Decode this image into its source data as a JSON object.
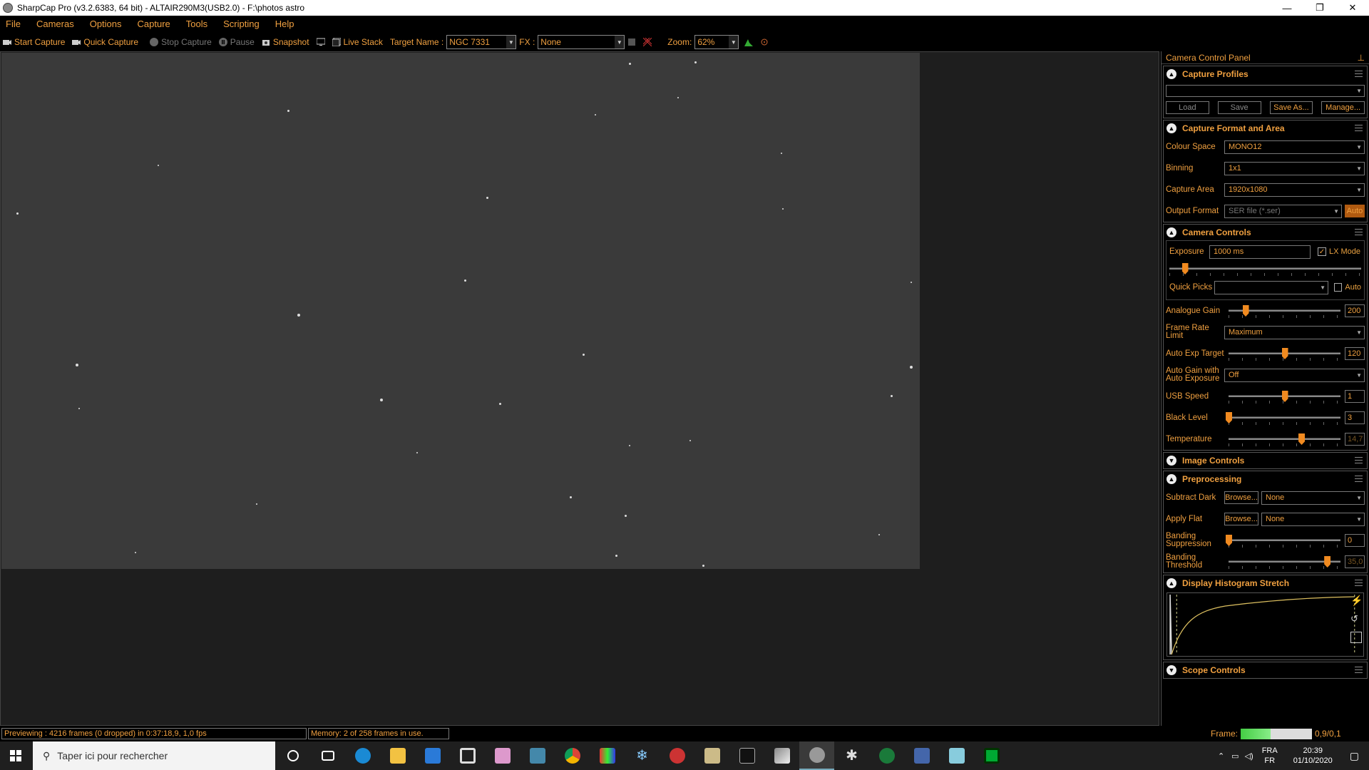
{
  "window": {
    "title": "SharpCap Pro (v3.2.6383, 64 bit) - ALTAIR290M3(USB2.0) - F:\\photos astro",
    "min": "—",
    "max": "❐",
    "close": "✕"
  },
  "menu": [
    "File",
    "Cameras",
    "Options",
    "Capture",
    "Tools",
    "Scripting",
    "Help"
  ],
  "toolbar": {
    "start_capture": "Start Capture",
    "quick_capture": "Quick Capture",
    "stop_capture": "Stop Capture",
    "pause": "Pause",
    "snapshot": "Snapshot",
    "live_stack": "Live Stack",
    "target_label": "Target Name :",
    "target_value": "NGC 7331",
    "fx_label": "FX :",
    "fx_value": "None",
    "zoom_label": "Zoom:",
    "zoom_value": "62%"
  },
  "status": {
    "preview": "Previewing : 4216 frames (0 dropped) in 0:37:18,9, 1,0 fps",
    "memory": "Memory: 2 of 258 frames in use.",
    "frame_label": "Frame:",
    "frame_value": "0,9/0,1"
  },
  "panel": {
    "title": "Camera Control Panel",
    "capture_profiles": {
      "title": "Capture Profiles",
      "load": "Load",
      "save": "Save",
      "save_as": "Save As...",
      "manage": "Manage..."
    },
    "format": {
      "title": "Capture Format and Area",
      "colour_space_label": "Colour Space",
      "colour_space": "MONO12",
      "binning_label": "Binning",
      "binning": "1x1",
      "area_label": "Capture Area",
      "area": "1920x1080",
      "output_label": "Output Format",
      "output": "SER file (*.ser)",
      "auto": "Auto"
    },
    "camera": {
      "title": "Camera Controls",
      "exposure_label": "Exposure",
      "exposure": "1000 ms",
      "lx_mode": "LX Mode",
      "lx_checked": true,
      "exposure_level": 0.08,
      "quick_picks_label": "Quick Picks",
      "quick_auto": "Auto",
      "gain_label": "Analogue Gain",
      "gain": "200",
      "gain_level": 0.15,
      "frame_rate_label": "Frame Rate Limit",
      "frame_rate": "Maximum",
      "auto_exp_label": "Auto Exp Target",
      "auto_exp": "120",
      "auto_exp_level": 0.5,
      "auto_gain_label": "Auto Gain with Auto Exposure",
      "auto_gain": "Off",
      "usb_label": "USB Speed",
      "usb": "1",
      "usb_level": 0.5,
      "black_label": "Black Level",
      "black": "3",
      "black_level": 0.0,
      "temp_label": "Temperature",
      "temp": "14,7",
      "temp_level": 0.65
    },
    "image_controls": {
      "title": "Image Controls"
    },
    "preprocessing": {
      "title": "Preprocessing",
      "dark_label": "Subtract Dark",
      "browse": "Browse...",
      "dark": "None",
      "flat_label": "Apply Flat",
      "flat": "None",
      "banding_sup_label": "Banding Suppression",
      "banding_sup": "0",
      "banding_sup_level": 0.0,
      "banding_thr_label": "Banding Threshold",
      "banding_thr": "35,0",
      "banding_thr_level": 0.88
    },
    "histogram": {
      "title": "Display Histogram Stretch"
    },
    "scope": {
      "title": "Scope Controls"
    }
  },
  "taskbar": {
    "search_placeholder": "Taper ici pour rechercher",
    "lang1": "FRA",
    "lang2": "FR",
    "time": "20:39",
    "date": "01/10/2020"
  },
  "colors": {
    "accent": "#f0a040",
    "slider": "#f08a20"
  }
}
